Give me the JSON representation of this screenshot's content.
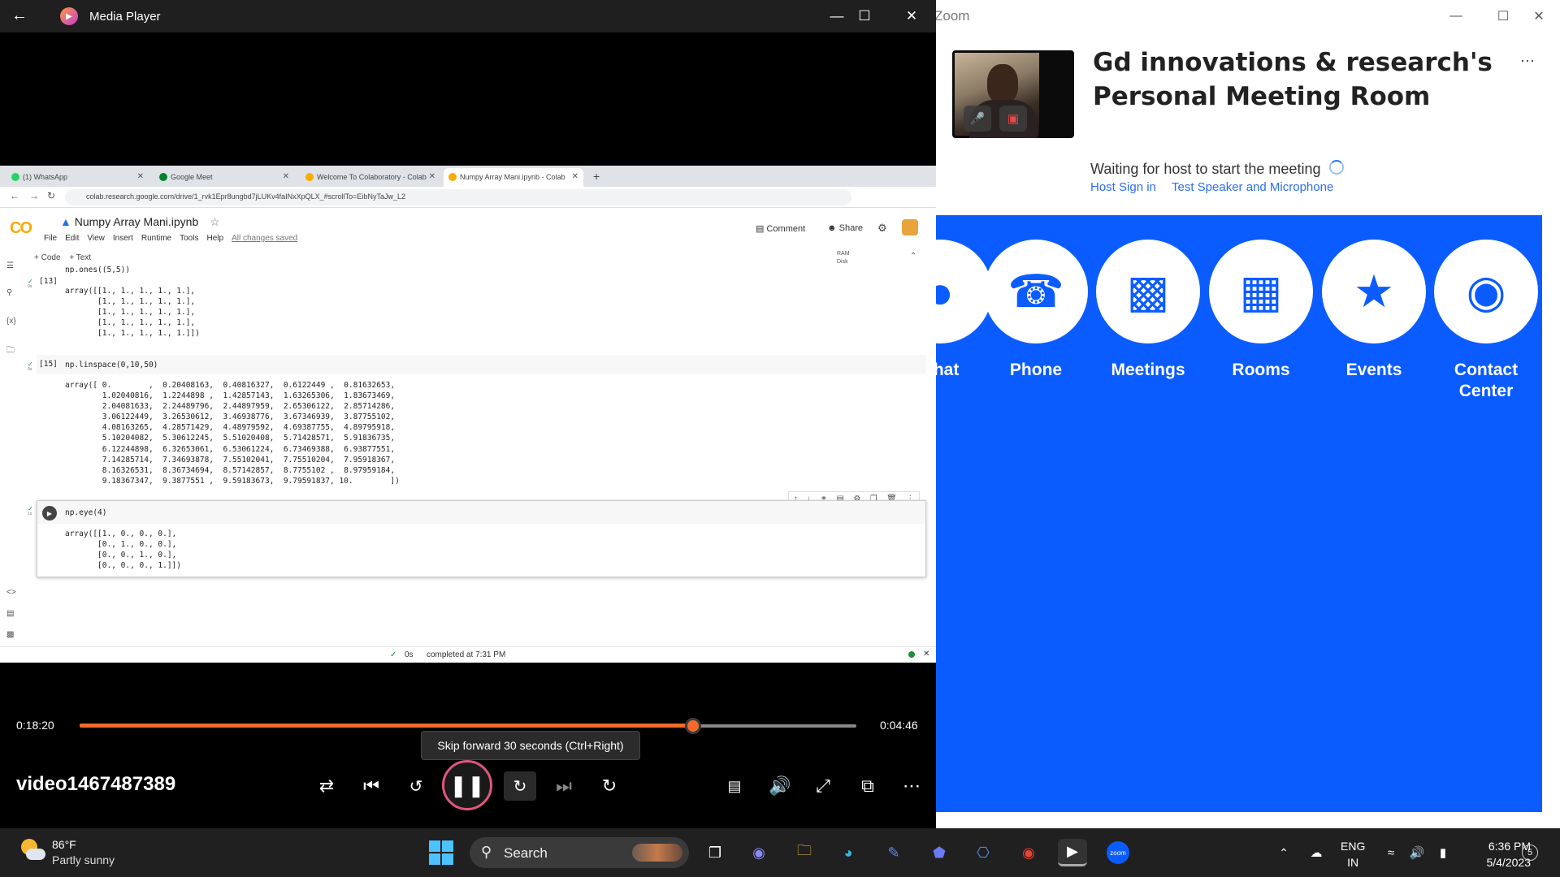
{
  "zoom": {
    "window_title": "Zoom",
    "heading": "Gd innovations & research's Personal Meeting Room",
    "more": "···",
    "waiting": "Waiting for host to start the meeting",
    "links": [
      "Host Sign in",
      "Test Speaker and Microphone"
    ],
    "apps": [
      {
        "label": "Chat",
        "icon": "chat-icon"
      },
      {
        "label": "Phone",
        "icon": "phone-icon"
      },
      {
        "label": "Meetings",
        "icon": "video-camera-icon"
      },
      {
        "label": "Rooms",
        "icon": "rooms-icon"
      },
      {
        "label": "Events",
        "icon": "ticket-icon"
      },
      {
        "label": "Contact Center",
        "icon": "headset-icon"
      }
    ],
    "brand_color": "#0b5cff"
  },
  "player": {
    "title": "Media Player",
    "current_time": "0:18:20",
    "remaining_time": "0:04:46",
    "progress": 0.79,
    "tooltip": "Skip forward 30 seconds (Ctrl+Right)",
    "video_name": "video1467487389",
    "accent_color": "#f26b2a"
  },
  "browser": {
    "tabs": [
      {
        "label": "(1) WhatsApp",
        "color": "#25d366"
      },
      {
        "label": "Google Meet",
        "color": "#00832d"
      },
      {
        "label": "Welcome To Colaboratory - Colab",
        "color": "#f9ab00"
      },
      {
        "label": "Numpy Array Mani.ipynb - Colab",
        "color": "#f9ab00"
      }
    ],
    "url": "colab.research.google.com/drive/1_rvk1Epr8ungbd7jLUKv4faINxXpQLX_#scrollTo=EibNyTaJw_L2"
  },
  "colab": {
    "logo": "CO",
    "notebook_title": "Numpy Array Mani.ipynb",
    "menu": [
      "File",
      "Edit",
      "View",
      "Insert",
      "Runtime",
      "Tools",
      "Help"
    ],
    "saved": "All changes saved",
    "comment": "Comment",
    "share": "Share",
    "add_code": "+ Code",
    "add_text": "+ Text",
    "ram": "RAM",
    "disk": "Disk",
    "cell1_partial": "np.ones((5,5))",
    "cell1_exec": "[13]",
    "cell1_output": "array([[1., 1., 1., 1., 1.],\n       [1., 1., 1., 1., 1.],\n       [1., 1., 1., 1., 1.],\n       [1., 1., 1., 1., 1.],\n       [1., 1., 1., 1., 1.]])",
    "cell2_exec": "[15]",
    "cell2_code": "np.linspace(0,10,50)",
    "cell2_output": "array([ 0.        ,  0.20408163,  0.40816327,  0.6122449 ,  0.81632653,\n        1.02040816,  1.2244898 ,  1.42857143,  1.63265306,  1.83673469,\n        2.04081633,  2.24489796,  2.44897959,  2.65306122,  2.85714286,\n        3.06122449,  3.26530612,  3.46938776,  3.67346939,  3.87755102,\n        4.08163265,  4.28571429,  4.48979592,  4.69387755,  4.89795918,\n        5.10204082,  5.30612245,  5.51020408,  5.71428571,  5.91836735,\n        6.12244898,  6.32653061,  6.53061224,  6.73469388,  6.93877551,\n        7.14285714,  7.34693878,  7.55102041,  7.75510204,  7.95918367,\n        8.16326531,  8.36734694,  8.57142857,  8.7755102 ,  8.97959184,\n        9.18367347,  9.3877551 ,  9.59183673,  9.79591837, 10.        ])",
    "cell3_code": "np.eye(4)",
    "cell3_output": "array([[1., 0., 0., 0.],\n       [0., 1., 0., 0.],\n       [0., 0., 1., 0.],\n       [0., 0., 0., 1.]])",
    "status_time": "0s",
    "status_text": "completed at 7:31 PM",
    "exec_secs": "0s",
    "exec_secs_running": "1s"
  },
  "taskbar": {
    "temperature": "86°F",
    "weather": "Partly sunny",
    "search": "Search",
    "lang": "ENG",
    "region": "IN",
    "time": "6:36 PM",
    "date": "5/4/2023",
    "notifications": "5"
  }
}
